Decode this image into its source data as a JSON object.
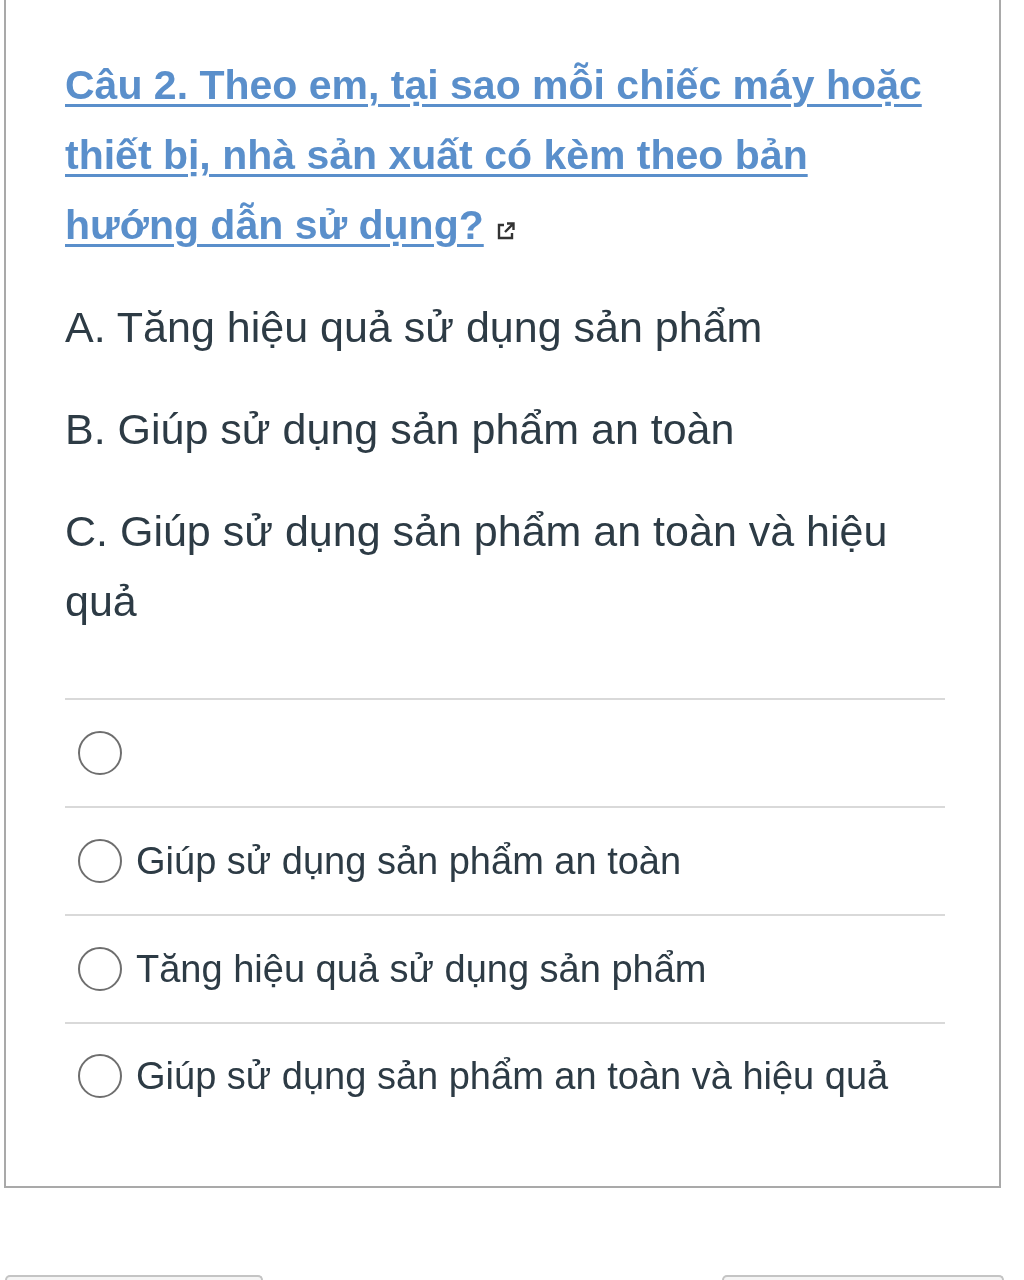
{
  "question": {
    "title": "Câu 2. Theo em, tại sao mỗi chiếc máy hoặc thiết bị, nhà sản xuất có kèm theo bản hướng dẫn sử dụng?"
  },
  "statements": [
    "A. Tăng hiệu quả sử dụng sản phẩm",
    "B. Giúp sử dụng sản phẩm an toàn",
    "C. Giúp sử dụng sản phẩm an toàn và hiệu quả"
  ],
  "answers": [
    {
      "selected": false
    },
    {
      "label": "Giúp sử dụng sản phẩm an toàn",
      "selected": false
    },
    {
      "label": "Tăng hiệu quả sử dụng sản phẩm",
      "selected": false
    },
    {
      "label": "Giúp sử dụng sản phẩm an toàn và hiệu quả",
      "selected": false
    }
  ]
}
